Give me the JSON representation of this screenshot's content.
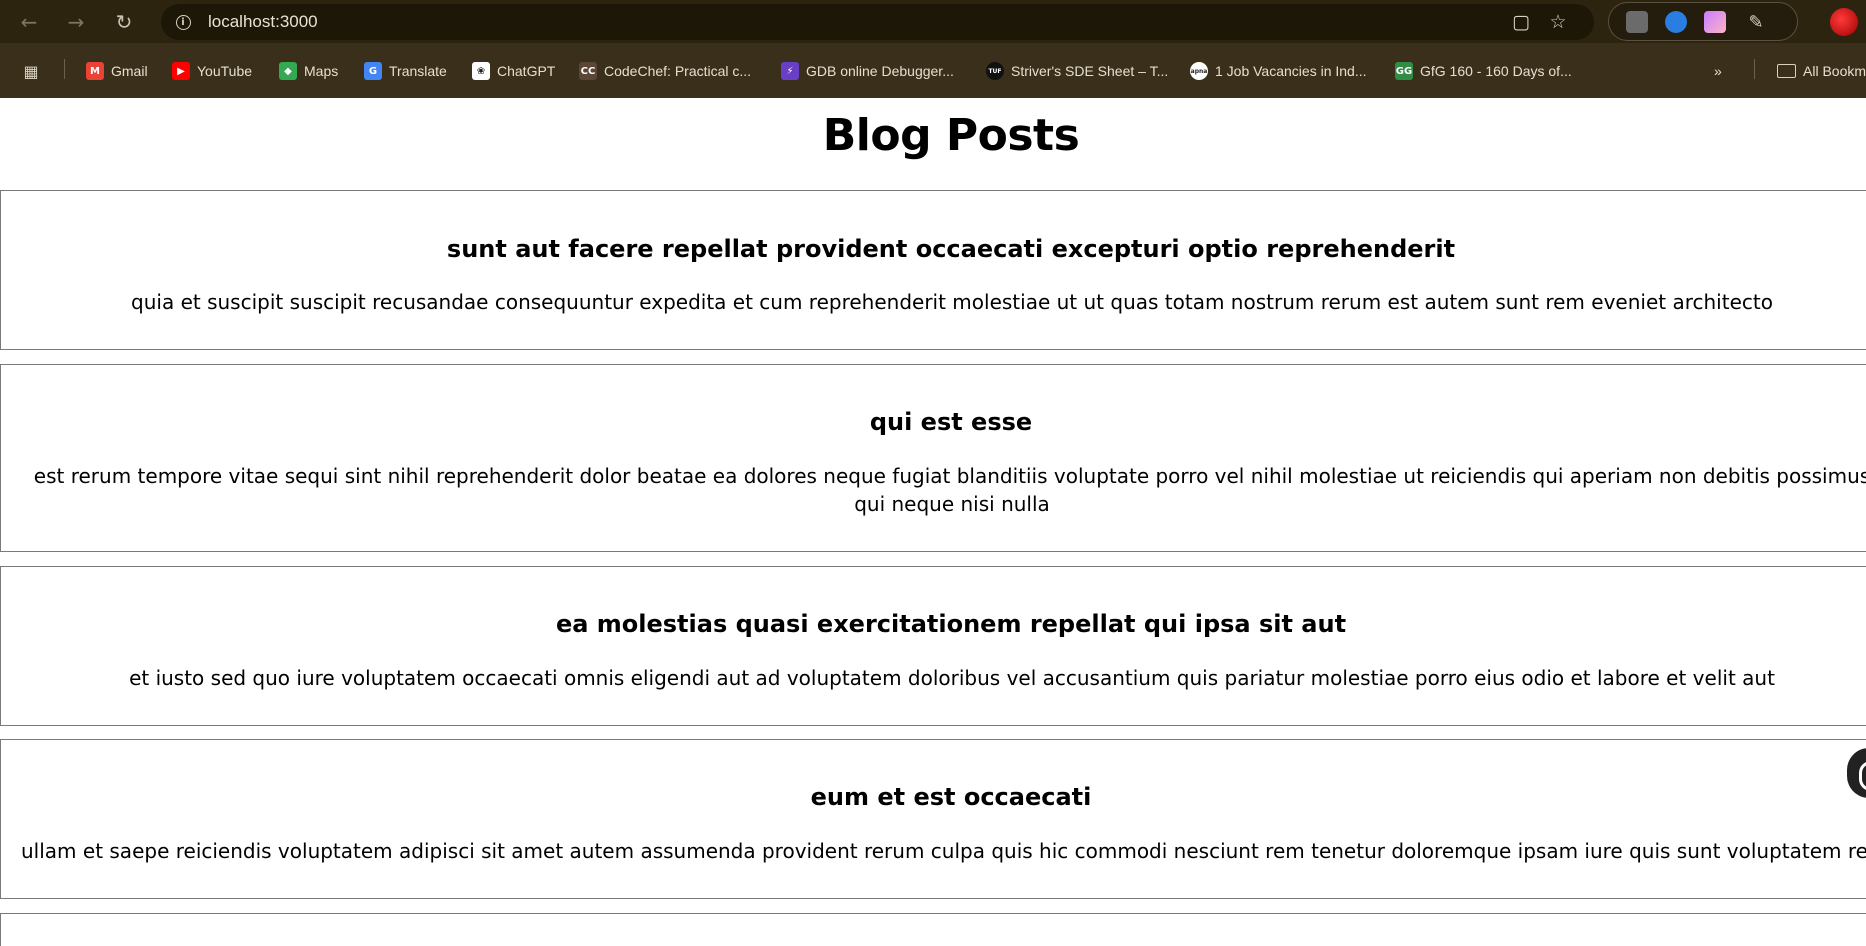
{
  "browser": {
    "url": "localhost:3000",
    "bookmarks": [
      {
        "label": "Gmail",
        "icon": "gmail-icon",
        "color": "#ea4335"
      },
      {
        "label": "YouTube",
        "icon": "youtube-icon",
        "color": "#ff0000"
      },
      {
        "label": "Maps",
        "icon": "maps-icon",
        "color": "#34a853"
      },
      {
        "label": "Translate",
        "icon": "translate-icon",
        "color": "#4285f4"
      },
      {
        "label": "ChatGPT",
        "icon": "chatgpt-icon",
        "color": "#ffffff"
      },
      {
        "label": "CodeChef: Practical c...",
        "icon": "codechef-icon",
        "color": "#5b4638"
      },
      {
        "label": "GDB online Debugger...",
        "icon": "gdb-icon",
        "color": "#6a3fc8"
      },
      {
        "label": "Striver's SDE Sheet – T...",
        "icon": "tuf-icon",
        "color": "#111111"
      },
      {
        "label": "1 Job Vacancies in Ind...",
        "icon": "apna-icon",
        "color": "#ffffff"
      },
      {
        "label": "GfG 160 - 160 Days of...",
        "icon": "gfg-icon",
        "color": "#2f8d46"
      }
    ],
    "all_bookmarks_label": "All Bookmarks"
  },
  "page": {
    "title": "Blog Posts",
    "posts": [
      {
        "title": "sunt aut facere repellat provident occaecati excepturi optio reprehenderit",
        "body": "quia et suscipit suscipit recusandae consequuntur expedita et cum reprehenderit molestiae ut ut quas totam nostrum rerum est autem sunt rem eveniet architecto"
      },
      {
        "title": "qui est esse",
        "body": "est rerum tempore vitae sequi sint nihil reprehenderit dolor beatae ea dolores neque fugiat blanditiis voluptate porro vel nihil molestiae ut reiciendis qui aperiam non debitis possimus qui neque nisi nulla"
      },
      {
        "title": "ea molestias quasi exercitationem repellat qui ipsa sit aut",
        "body": "et iusto sed quo iure voluptatem occaecati omnis eligendi aut ad voluptatem doloribus vel accusantium quis pariatur molestiae porro eius odio et labore et velit aut"
      },
      {
        "title": "eum et est occaecati",
        "body": "ullam et saepe reiciendis voluptatem adipisci sit amet autem assumenda provident rerum culpa quis hic commodi nesciunt rem tenetur doloremque ipsam iure quis sunt voluptatem rerum illo velit"
      }
    ]
  }
}
